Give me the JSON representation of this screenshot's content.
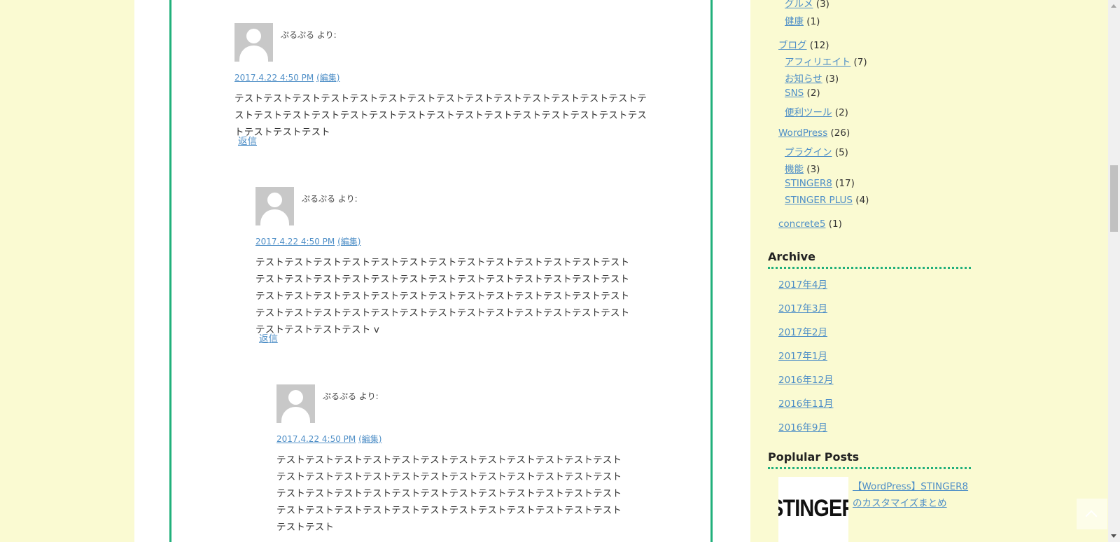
{
  "comments": [
    {
      "author": "ぷるぷる より:",
      "date": "2017.4.22 4:50 PM",
      "edit": "(編集)",
      "text": "テストテストテストテストテストテストテストテストテストテストテストテストテストテストテストテストテストテストテストテストテストテストテストテストテストテストテストテストテストテストテストテスト",
      "reply": "返信"
    },
    {
      "author": "ぷるぷる より:",
      "date": "2017.4.22 4:50 PM",
      "edit": "(編集)",
      "text": "テストテストテストテストテストテストテストテストテストテストテストテストテストテストテストテストテストテストテストテストテストテストテストテストテストテストテストテストテストテストテストテストテストテストテストテストテストテストテストテストテストテストテストテストテストテストテストテストテストテストテストテストテストテストテストテスト v",
      "reply": "返信"
    },
    {
      "author": "ぷるぷる より:",
      "date": "2017.4.22 4:50 PM",
      "edit": "(編集)",
      "text": "テストテストテストテストテストテストテストテストテストテストテストテストテストテストテストテストテストテストテストテストテストテストテストテストテストテストテストテストテストテストテストテストテストテストテストテストテストテストテストテストテストテストテストテストテストテストテストテストテストテスト"
    }
  ],
  "sidebar": {
    "categories": [
      {
        "label": "グルメ",
        "count": "(3)"
      },
      {
        "label": "健康",
        "count": "(1)"
      },
      {
        "label": "ブログ",
        "count": "(12)"
      },
      {
        "label": "アフィリエイト",
        "count": "(7)"
      },
      {
        "label": "お知らせ",
        "count": "(3)"
      },
      {
        "label": "SNS",
        "count": "(2)"
      },
      {
        "label": "便利ツール",
        "count": "(2)"
      },
      {
        "label": "WordPress",
        "count": "(26)"
      },
      {
        "label": "プラグイン",
        "count": "(5)"
      },
      {
        "label": "機能",
        "count": "(3)"
      },
      {
        "label": "STINGER8",
        "count": "(17)"
      },
      {
        "label": "STINGER PLUS",
        "count": "(4)"
      },
      {
        "label": "concrete5",
        "count": "(1)"
      }
    ],
    "archive_title": "Archive",
    "archives": [
      "2017年4月",
      "2017年3月",
      "2017年2月",
      "2017年1月",
      "2016年12月",
      "2016年11月",
      "2016年9月"
    ],
    "popular_title": "Poplular Posts",
    "popular_post": {
      "thumb_text": "STINGER",
      "title": "【WordPress】STINGER8のカスタマイズまとめ"
    }
  },
  "colors": {
    "accent": "#21b07b",
    "background": "#fafad2",
    "link": "#4f8fc7"
  }
}
